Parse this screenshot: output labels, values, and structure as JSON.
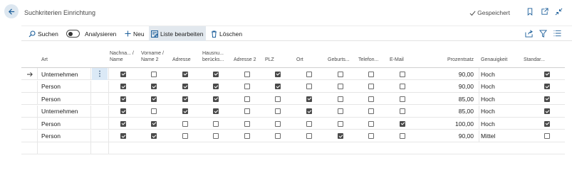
{
  "page": {
    "title": "Suchkriterien Einrichtung",
    "saved_label": "Gespeichert"
  },
  "toolbar": {
    "search_label": "Suchen",
    "analyze_label": "Analysieren",
    "new_label": "Neu",
    "edit_list_label": "Liste bearbeiten",
    "delete_label": "Löschen"
  },
  "columns": [
    {
      "key": "art",
      "label": "Art"
    },
    {
      "key": "nachname",
      "label": "Nachna... / Name"
    },
    {
      "key": "vorname",
      "label": "Vorname / Name 2"
    },
    {
      "key": "adresse",
      "label": "Adresse"
    },
    {
      "key": "hausnr",
      "label": "Hausnu... berücks..."
    },
    {
      "key": "adresse2",
      "label": "Adresse 2"
    },
    {
      "key": "plz",
      "label": "PLZ"
    },
    {
      "key": "ort",
      "label": "Ort"
    },
    {
      "key": "geburt",
      "label": "Geburts..."
    },
    {
      "key": "telefon",
      "label": "Telefon..."
    },
    {
      "key": "email",
      "label": "E-Mail"
    },
    {
      "key": "prozent",
      "label": "Prozentsatz"
    },
    {
      "key": "genauigkeit",
      "label": "Genauigkeit"
    },
    {
      "key": "standard",
      "label": "Standar..."
    }
  ],
  "rows": [
    {
      "art": "Unternehmen",
      "checks": [
        true,
        false,
        true,
        true,
        false,
        true,
        false,
        false,
        false,
        false
      ],
      "prozent": "90,00",
      "genauigkeit": "Hoch",
      "standard": true
    },
    {
      "art": "Person",
      "checks": [
        true,
        true,
        true,
        true,
        false,
        true,
        false,
        false,
        false,
        false
      ],
      "prozent": "90,00",
      "genauigkeit": "Hoch",
      "standard": true
    },
    {
      "art": "Person",
      "checks": [
        true,
        true,
        true,
        true,
        false,
        false,
        true,
        false,
        false,
        false
      ],
      "prozent": "85,00",
      "genauigkeit": "Hoch",
      "standard": true
    },
    {
      "art": "Unternehmen",
      "checks": [
        true,
        false,
        true,
        true,
        false,
        false,
        true,
        false,
        false,
        false
      ],
      "prozent": "85,00",
      "genauigkeit": "Hoch",
      "standard": true
    },
    {
      "art": "Person",
      "checks": [
        true,
        true,
        false,
        false,
        false,
        false,
        false,
        false,
        false,
        true
      ],
      "prozent": "100,00",
      "genauigkeit": "Hoch",
      "standard": true
    },
    {
      "art": "Person",
      "checks": [
        true,
        true,
        false,
        false,
        false,
        false,
        false,
        true,
        false,
        false
      ],
      "prozent": "90,00",
      "genauigkeit": "Mittel",
      "standard": false
    }
  ],
  "icons": {
    "back": "back-arrow-icon",
    "saved": "checkmark-icon",
    "bookmark": "bookmark-icon",
    "open_new": "open-in-new-window-icon",
    "collapse": "collapse-icon",
    "search": "search-icon",
    "new": "plus-icon",
    "edit_list": "edit-list-icon",
    "delete": "trash-icon",
    "share": "share-icon",
    "filter": "filter-icon",
    "list_view": "list-view-icon",
    "row_pointer": "row-arrow-icon",
    "row_menu": "more-options-icon"
  },
  "colors": {
    "accent": "#1b5e9a",
    "active_action_bg": "#e2e8ee",
    "selected_cell_bg": "#dbe9f6"
  }
}
